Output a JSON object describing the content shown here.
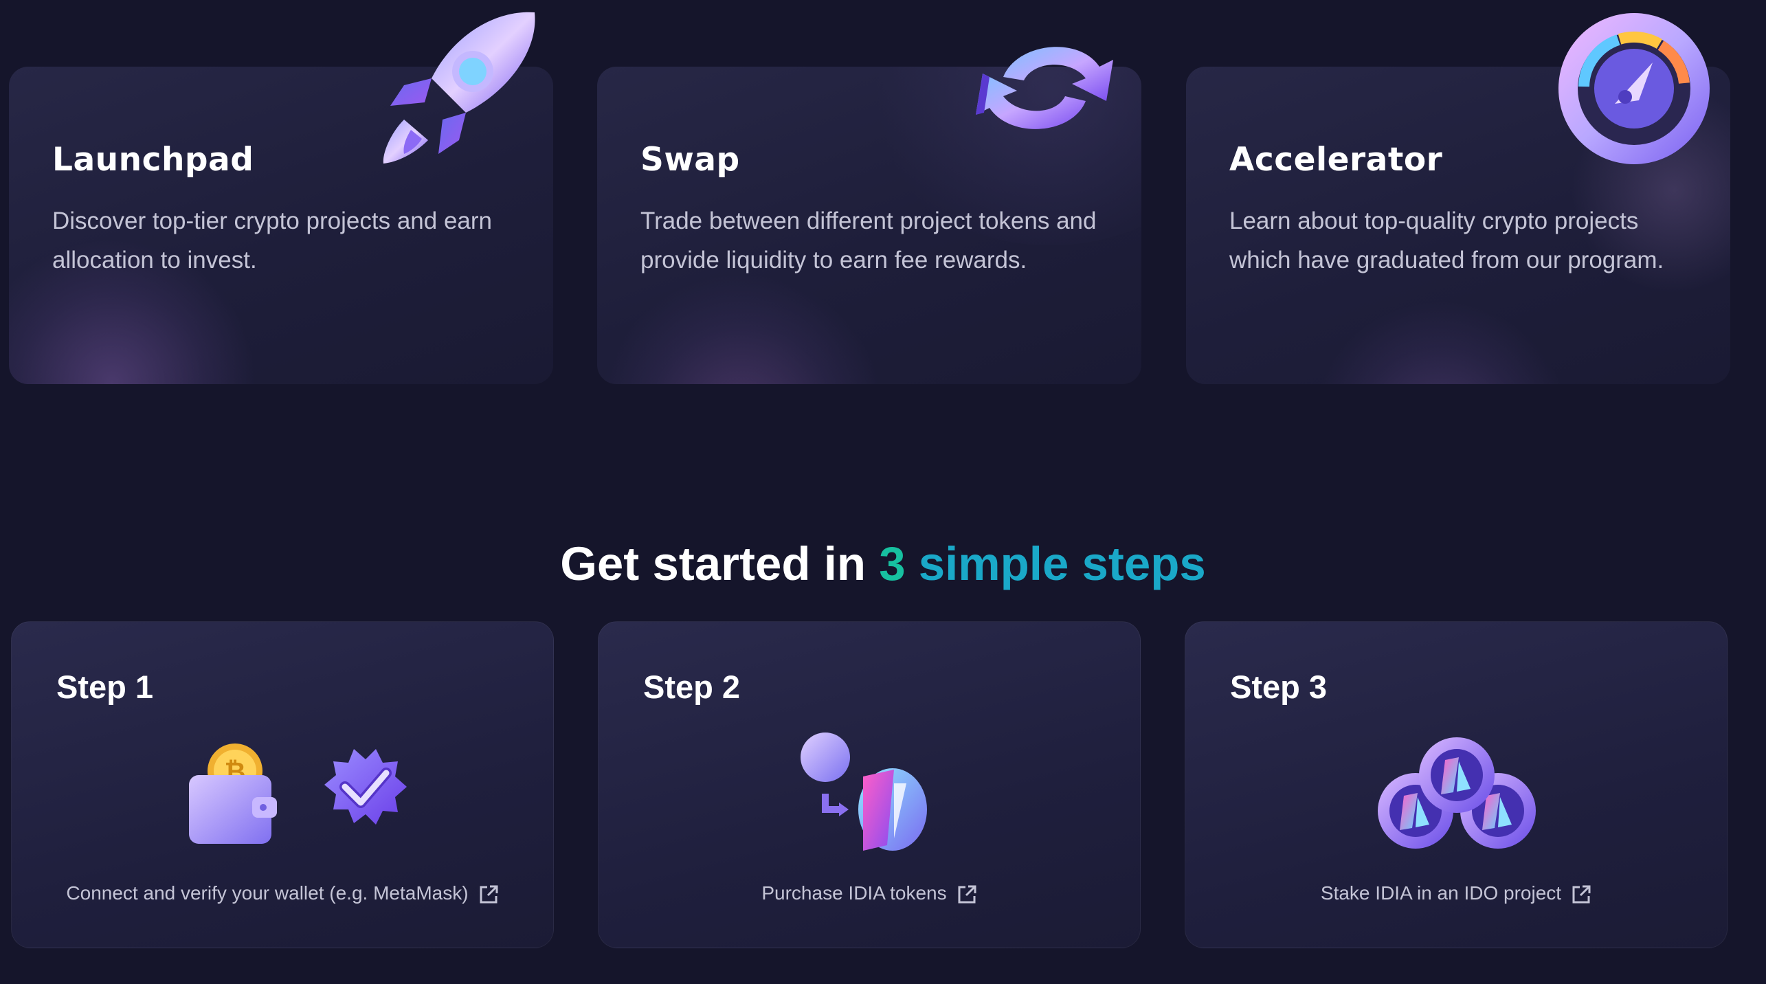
{
  "features": [
    {
      "title": "Launchpad",
      "description": "Discover top-tier crypto projects and earn allocation to invest.",
      "icon": "rocket-icon"
    },
    {
      "title": "Swap",
      "description": "Trade between different project tokens and provide liquidity to earn fee rewards.",
      "icon": "swap-arrows-icon"
    },
    {
      "title": "Accelerator",
      "description": "Learn about top-quality crypto projects which have graduated from our program.",
      "icon": "speedometer-icon"
    }
  ],
  "steps_heading": {
    "prefix": "Get started in ",
    "num": "3",
    "rest": " simple steps"
  },
  "steps": [
    {
      "title": "Step 1",
      "link": "Connect and verify your wallet (e.g. MetaMask)",
      "icon": "wallet-verify-icon"
    },
    {
      "title": "Step 2",
      "link": "Purchase IDIA tokens",
      "icon": "purchase-token-icon"
    },
    {
      "title": "Step 3",
      "link": "Stake IDIA in an IDO project",
      "icon": "stake-coins-icon"
    }
  ],
  "colors": {
    "background": "#15152b",
    "accent_green": "#17c0a0",
    "accent_blue": "#1aa8c8"
  }
}
